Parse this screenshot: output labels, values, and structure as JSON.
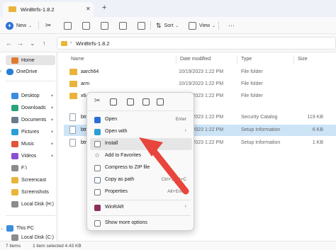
{
  "window": {
    "tab_title": "WinBtrfs-1.8.2",
    "close_tab": "✕",
    "new_tab": "+"
  },
  "toolbar": {
    "new_label": "New",
    "sort_label": "Sort",
    "view_label": "View",
    "more_label": "···"
  },
  "address": {
    "path": "WinBtrfs-1.8.2",
    "separator": "›"
  },
  "sidebar": {
    "items": [
      {
        "label": "Home",
        "icon": "home-icon",
        "color": "#e07a2f"
      },
      {
        "label": "OneDrive",
        "icon": "cloud-icon",
        "color": "#2a7fd6"
      },
      {
        "label": "Desktop",
        "icon": "desktop-icon",
        "color": "#3a8de0"
      },
      {
        "label": "Downloads",
        "icon": "download-icon",
        "color": "#2aa37a"
      },
      {
        "label": "Documents",
        "icon": "documents-icon",
        "color": "#6b7b8c"
      },
      {
        "label": "Pictures",
        "icon": "pictures-icon",
        "color": "#2a9fd6"
      },
      {
        "label": "Music",
        "icon": "music-icon",
        "color": "#e0543a"
      },
      {
        "label": "Videos",
        "icon": "videos-icon",
        "color": "#8a4fd0"
      },
      {
        "label": "F:\\",
        "icon": "drive-icon",
        "color": "#8c8c8c"
      },
      {
        "label": "Screencast",
        "icon": "folder-icon",
        "color": "#e9b43a"
      },
      {
        "label": "Screenshots",
        "icon": "folder-icon",
        "color": "#e9b43a"
      },
      {
        "label": "Local Disk (H:)",
        "icon": "drive-icon",
        "color": "#8c8c8c"
      },
      {
        "label": "This PC",
        "icon": "pc-icon",
        "color": "#3a8de0"
      },
      {
        "label": "Local Disk (C:)",
        "icon": "drive-icon",
        "color": "#8c8c8c"
      }
    ]
  },
  "columns": {
    "name": "Name",
    "date": "Date modified",
    "type": "Type",
    "size": "Size"
  },
  "files": [
    {
      "name": "aarch64",
      "date": "10/19/2023 1:22 PM",
      "type": "File folder",
      "size": "",
      "kind": "folder"
    },
    {
      "name": "arm",
      "date": "10/19/2023 1:22 PM",
      "type": "File folder",
      "size": "",
      "kind": "folder"
    },
    {
      "name": "x64",
      "date": "10/19/2023 1:22 PM",
      "type": "File folder",
      "size": "",
      "kind": "folder"
    },
    {
      "name": "btrfs",
      "date": "10/19/2023 1:22 PM",
      "type": "Security Catalog",
      "size": "119 KB",
      "kind": "file"
    },
    {
      "name": "btrfs",
      "date": "10/19/2023 1:22 PM",
      "type": "Setup Information",
      "size": "6 KB",
      "kind": "file"
    },
    {
      "name": "btrfs",
      "date": "10/19/2023 1:22 PM",
      "type": "Setup Information",
      "size": "1 KB",
      "kind": "file"
    }
  ],
  "status": {
    "items": "7 items",
    "selected": "1 item selected  4.43 KB"
  },
  "context_menu": {
    "quick_actions": [
      "cut-icon",
      "copy-icon",
      "share-icon",
      "delete-icon"
    ],
    "items": [
      {
        "label": "Open",
        "shortcut": "Enter",
        "icon": "open-icon",
        "color": "#2a6fd6"
      },
      {
        "label": "Open with",
        "shortcut": "",
        "submenu": "›",
        "icon": "open-with-icon",
        "color": "#2a9fd6"
      },
      {
        "label": "Install",
        "shortcut": "",
        "icon": "install-icon",
        "color": "#6b7b8c"
      },
      {
        "label": "Add to Favorites",
        "shortcut": "",
        "icon": "star-icon",
        "color": "#6b7b8c"
      },
      {
        "label": "Compress to ZIP file",
        "shortcut": "",
        "icon": "zip-icon",
        "color": "#6b7b8c"
      },
      {
        "label": "Copy as path",
        "shortcut": "Ctrl+Shift+C",
        "icon": "path-icon",
        "color": "#6b7b8c"
      },
      {
        "label": "Properties",
        "shortcut": "Alt+Enter",
        "icon": "properties-icon",
        "color": "#6b7b8c"
      },
      {
        "label": "WinRAR",
        "shortcut": "",
        "submenu": "›",
        "icon": "winrar-icon",
        "color": "#8a2f5a"
      },
      {
        "label": "Show more options",
        "shortcut": "",
        "icon": "more-options-icon",
        "color": "#6b7b8c"
      }
    ]
  },
  "colors": {
    "accent": "#2a6fd6",
    "folder": "#e9b43a",
    "selection": "#cde4f7",
    "arrow": "#e8453c"
  }
}
